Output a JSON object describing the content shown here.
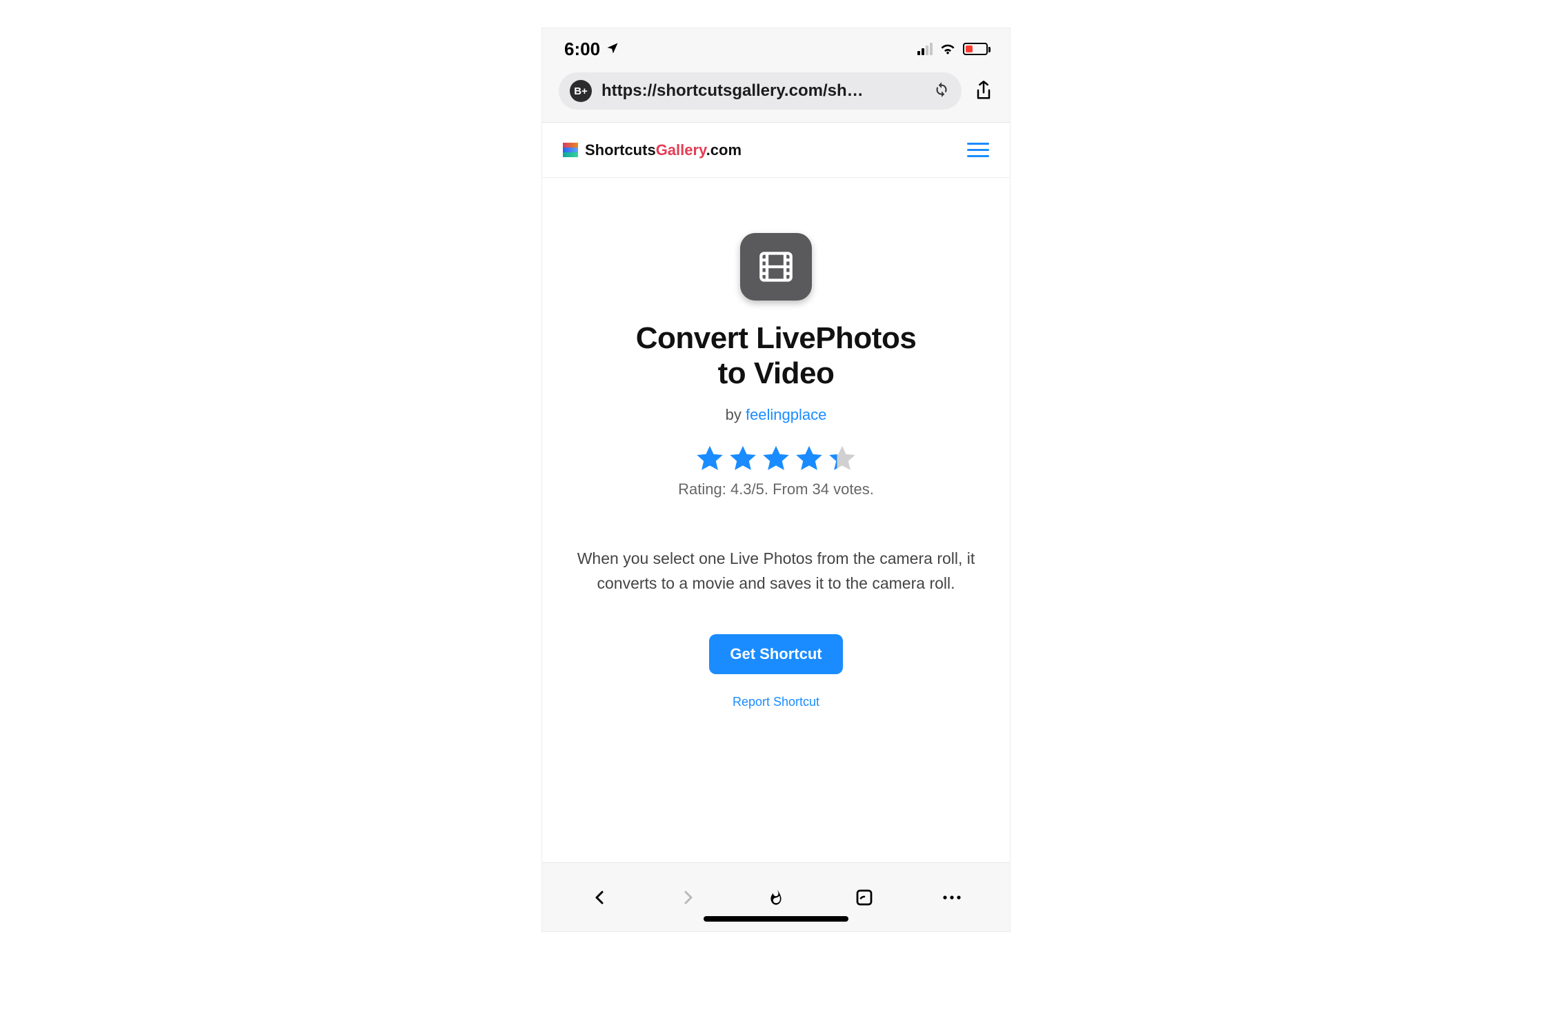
{
  "status": {
    "time": "6:00"
  },
  "browser": {
    "badge": "B+",
    "url": "https://shortcutsgallery.com/sh…"
  },
  "site": {
    "logo_part1": "Shortcuts",
    "logo_part2": "Gallery",
    "logo_part3": ".com"
  },
  "page": {
    "title_line1": "Convert LivePhotos",
    "title_line2": "to Video",
    "by_label": "by ",
    "author": "feelingplace",
    "rating_value": 4.3,
    "rating_text": "Rating: 4.3/5. From 34 votes.",
    "description": "When you select one Live Photos from the camera roll, it converts to a movie and saves it to the camera roll.",
    "cta_label": "Get Shortcut",
    "report_label": "Report Shortcut"
  }
}
